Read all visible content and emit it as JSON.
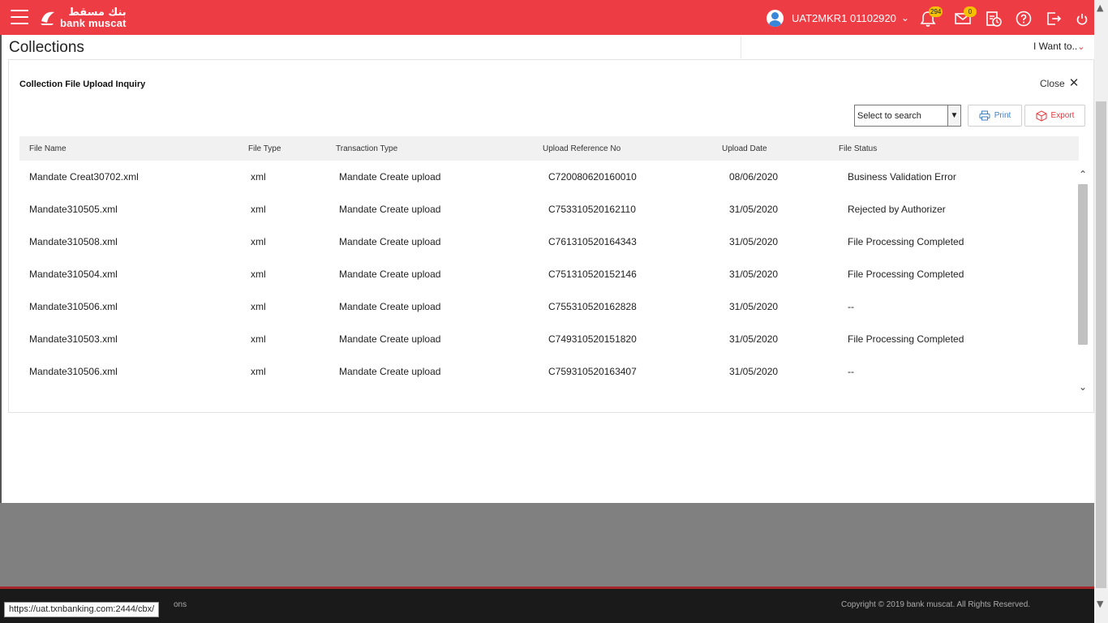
{
  "header": {
    "logo_arabic": "بنك مسقط",
    "logo_english": "bank muscat",
    "user_name": "UAT2MKR1 01102920",
    "notifications_count": "294",
    "messages_count": "0",
    "brand_color": "#ee3c45"
  },
  "page": {
    "title": "Collections",
    "i_want_to": "I Want to.."
  },
  "panel": {
    "title": "Collection File Upload Inquiry",
    "close_label": "Close",
    "search_select_value": "Select to search",
    "print_label": "Print",
    "export_label": "Export"
  },
  "table": {
    "columns": [
      "File Name",
      "File Type",
      "Transaction Type",
      "Upload Reference No",
      "Upload Date",
      "File Status"
    ],
    "rows": [
      [
        "Mandate Creat30702.xml",
        "xml",
        "Mandate Create upload",
        "C720080620160010",
        "08/06/2020",
        "Business Validation Error"
      ],
      [
        "Mandate310505.xml",
        "xml",
        "Mandate Create upload",
        "C753310520162110",
        "31/05/2020",
        "Rejected by Authorizer"
      ],
      [
        "Mandate310508.xml",
        "xml",
        "Mandate Create upload",
        "C761310520164343",
        "31/05/2020",
        "File Processing Completed"
      ],
      [
        "Mandate310504.xml",
        "xml",
        "Mandate Create upload",
        "C751310520152146",
        "31/05/2020",
        "File Processing Completed"
      ],
      [
        "Mandate310506.xml",
        "xml",
        "Mandate Create upload",
        "C755310520162828",
        "31/05/2020",
        "--"
      ],
      [
        "Mandate310503.xml",
        "xml",
        "Mandate Create upload",
        "C749310520151820",
        "31/05/2020",
        "File Processing Completed"
      ],
      [
        "Mandate310506.xml",
        "xml",
        "Mandate Create upload",
        "C759310520163407",
        "31/05/2020",
        "--"
      ]
    ]
  },
  "footer": {
    "copyright": "Copyright © 2019 bank muscat. All Rights Reserved.",
    "partial_link": "ons",
    "status_url": "https://uat.txnbanking.com:2444/cbx/"
  }
}
